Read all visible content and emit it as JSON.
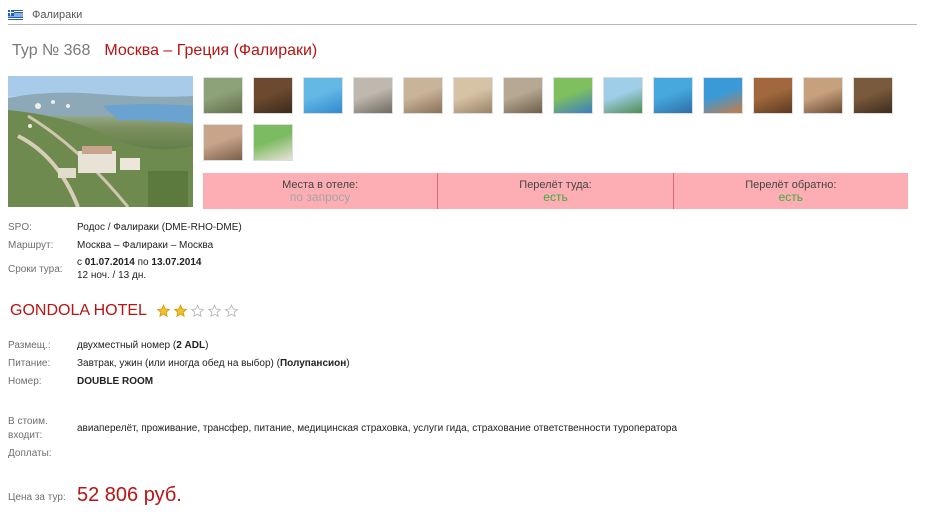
{
  "breadcrumb": {
    "flag_icon": "greece-flag-icon",
    "label": "Фалираки"
  },
  "tour": {
    "number": "Тур № 368",
    "route": "Москва – Греция (Фалираки)"
  },
  "gallery": {
    "thumbnails": [
      {
        "c1": "#8ea27a",
        "c2": "#5f6f4a"
      },
      {
        "c1": "#6d4a2f",
        "c2": "#3b2a1c"
      },
      {
        "c1": "#64b8e4",
        "c2": "#2f8ad0"
      },
      {
        "c1": "#bfb8ae",
        "c2": "#6f6a62"
      },
      {
        "c1": "#c9b49a",
        "c2": "#8a7158"
      },
      {
        "c1": "#d6c3a6",
        "c2": "#9c8466"
      },
      {
        "c1": "#b7a893",
        "c2": "#6d5e4b"
      },
      {
        "c1": "#7fbf5f",
        "c2": "#3c7dc3"
      },
      {
        "c1": "#9fcfe8",
        "c2": "#4f8d53"
      },
      {
        "c1": "#46a8dc",
        "c2": "#2d6fa8"
      },
      {
        "c1": "#3a9ad8",
        "c2": "#c77b45"
      },
      {
        "c1": "#a0683c",
        "c2": "#5c3a22"
      },
      {
        "c1": "#c7a17e",
        "c2": "#6a4a31"
      },
      {
        "c1": "#7a5a3c",
        "c2": "#3d2c1d"
      },
      {
        "c1": "#c8a48a",
        "c2": "#7c5f49"
      },
      {
        "c1": "#7dbb62",
        "c2": "#e9e3d8"
      }
    ]
  },
  "status": {
    "hotel_places": {
      "label": "Места в отеле:",
      "value": "по запросу"
    },
    "flight_there": {
      "label": "Перелёт туда:",
      "value": "есть"
    },
    "flight_back": {
      "label": "Перелёт обратно:",
      "value": "есть"
    }
  },
  "details": {
    "spo_label": "SPO:",
    "spo_value": "Родос / Фалираки (DME-RHO-DME)",
    "route_label": "Маршрут:",
    "route_value": "Москва – Фалираки – Москва",
    "dates_label": "Сроки тура:",
    "dates_from_prefix": "с ",
    "dates_from": "01.07.2014",
    "dates_to_prefix": " по ",
    "dates_to": "13.07.2014",
    "duration": "12 ноч. / 13 дн."
  },
  "hotel": {
    "name": "GONDOLA HOTEL",
    "stars": 2,
    "max_stars": 5
  },
  "accommodation": {
    "room_label": "Размещ.:",
    "room_text": "двухместный номер (",
    "room_bold": "2 ADL",
    "room_end": ")",
    "meal_label": "Питание:",
    "meal_text": "Завтрак, ужин (или иногда обед на выбор) (",
    "meal_bold": "Полупансион",
    "meal_end": ")",
    "number_label": "Номер:",
    "number_value": "DOUBLE ROOM"
  },
  "included": {
    "label_line1": "В стоим.",
    "label_line2": "входит:",
    "value": "авиаперелёт, проживание, трансфер, питание, медицинская страховка, услуги гида, страхование ответственности туроператора",
    "extra_label": "Доплаты:",
    "extra_value": ""
  },
  "price": {
    "label": "Цена за тур:",
    "value": "52 806 руб."
  }
}
